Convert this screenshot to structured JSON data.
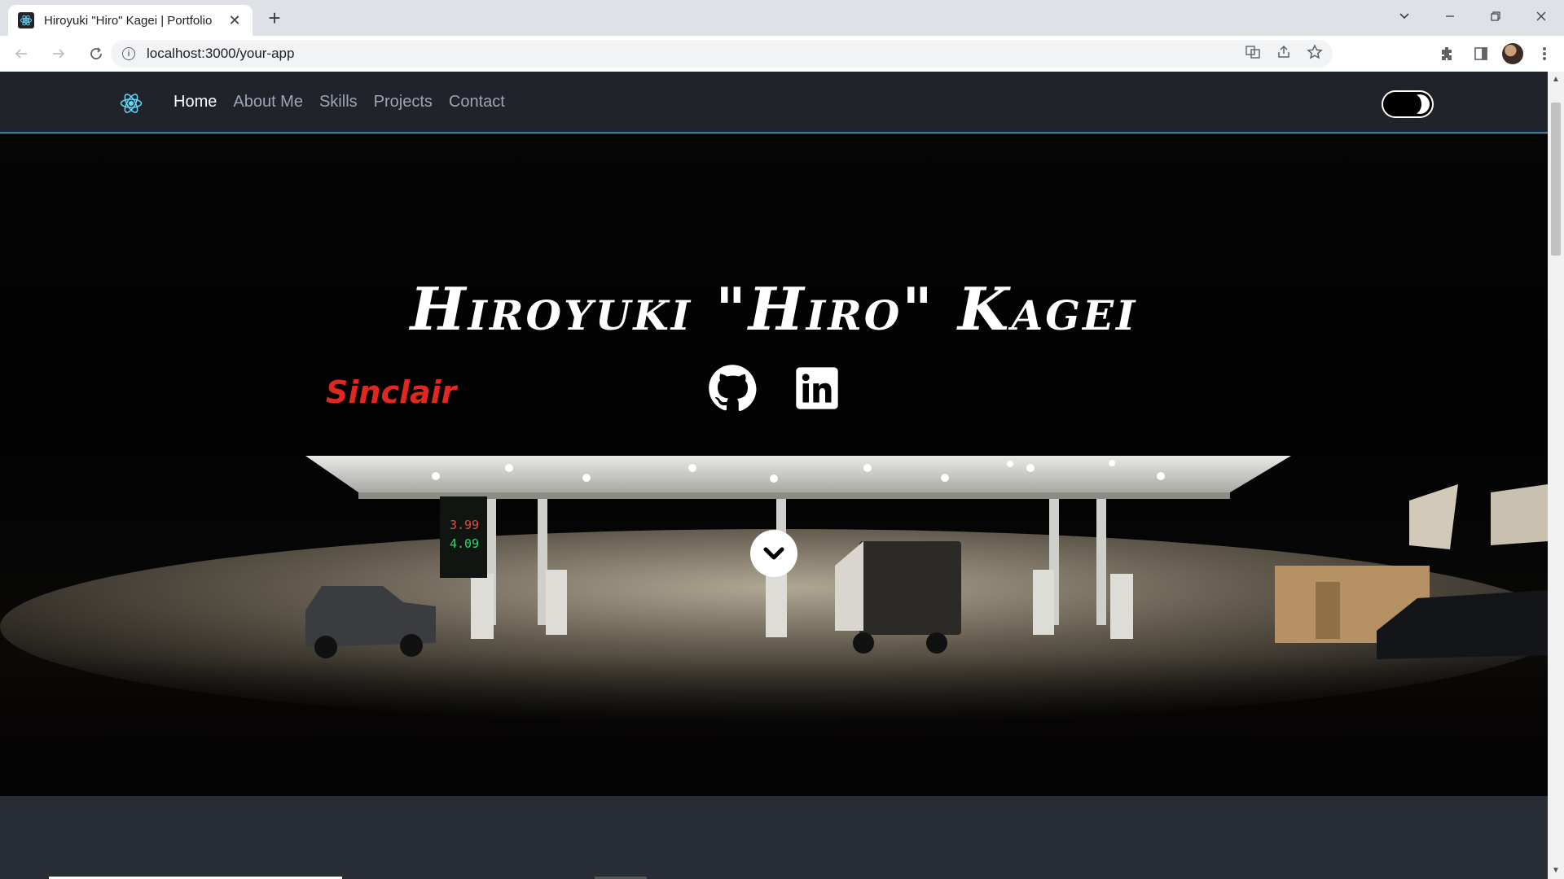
{
  "browser": {
    "tab_title": "Hiroyuki \"Hiro\" Kagei | Portfolio",
    "url": "localhost:3000/your-app"
  },
  "navbar": {
    "links": [
      {
        "label": "Home",
        "active": true
      },
      {
        "label": "About Me",
        "active": false
      },
      {
        "label": "Skills",
        "active": false
      },
      {
        "label": "Projects",
        "active": false
      },
      {
        "label": "Contact",
        "active": false
      }
    ],
    "theme_toggle": {
      "state": "dark"
    }
  },
  "hero": {
    "title": "Hiroyuki \"Hiro\" Kagei",
    "socials": [
      "github-icon",
      "linkedin-icon"
    ],
    "sign_text": "Sinclair",
    "price_1": "3.99",
    "price_2": "4.09"
  },
  "colors": {
    "accent": "#61dafb",
    "nav_bg": "#20232a",
    "nav_border": "#3b7d98",
    "page_bg": "#282c34"
  }
}
